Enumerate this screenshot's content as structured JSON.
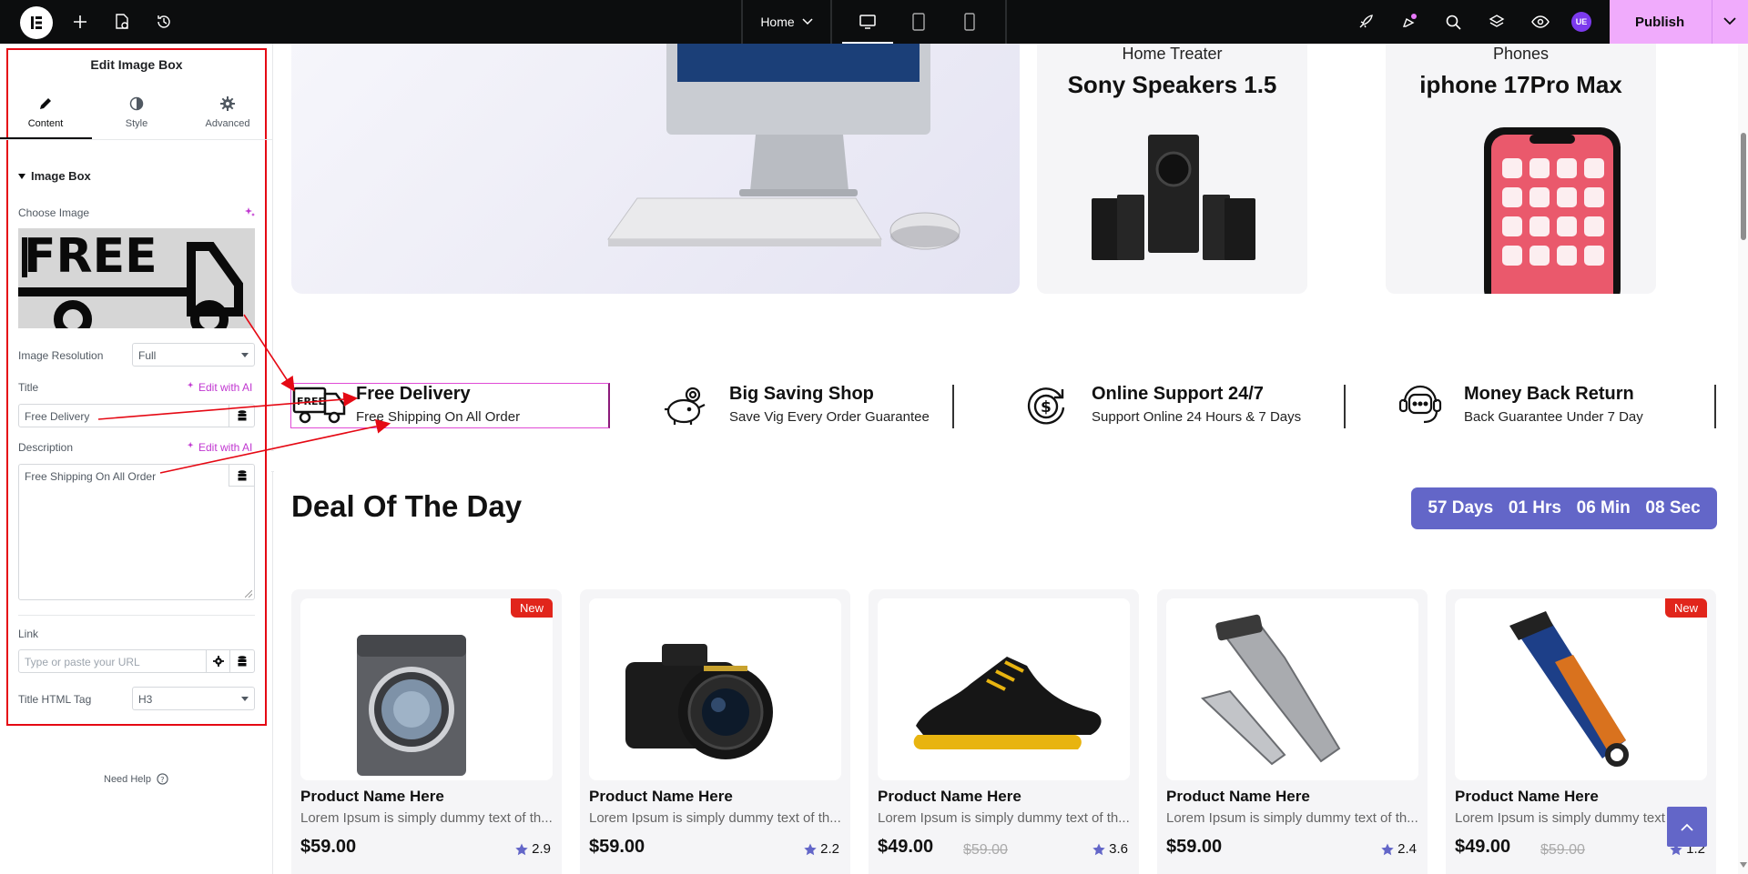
{
  "topbar": {
    "page_select": "Home",
    "publish_label": "Publish",
    "user_initials": "UE"
  },
  "panel": {
    "title": "Edit Image Box",
    "tabs": [
      {
        "label": "Content",
        "icon": "pencil-icon"
      },
      {
        "label": "Style",
        "icon": "contrast-icon"
      },
      {
        "label": "Advanced",
        "icon": "gear-icon"
      }
    ],
    "section_title": "Image Box",
    "choose_image_label": "Choose Image",
    "image_resolution_label": "Image Resolution",
    "image_resolution_value": "Full",
    "title_label": "Title",
    "title_value": "Free Delivery",
    "edit_with_ai": "Edit with AI",
    "description_label": "Description",
    "description_value": "Free Shipping On All Order",
    "link_label": "Link",
    "link_placeholder": "Type or paste your URL",
    "title_tag_label": "Title HTML Tag",
    "title_tag_value": "H3",
    "need_help": "Need Help",
    "frame_color": "#e50914"
  },
  "hero": {
    "cards": [
      {
        "category": "Home Treater",
        "title": "Sony Speakers 1.5"
      },
      {
        "category": "Phones",
        "title": "iphone 17Pro Max"
      }
    ]
  },
  "features": [
    {
      "title": "Free Delivery",
      "desc": "Free Shipping On All Order",
      "icon": "delivery-truck-icon"
    },
    {
      "title": "Big Saving Shop",
      "desc": "Save Vig Every Order Guarantee",
      "icon": "piggy-bank-icon"
    },
    {
      "title": "Online Support 24/7",
      "desc": "Support Online 24 Hours & 7 Days",
      "icon": "dollar-cycle-icon"
    },
    {
      "title": "Money Back Return",
      "desc": "Back Guarantee Under 7 Day",
      "icon": "support-chat-icon"
    }
  ],
  "deal": {
    "title": "Deal Of The Day",
    "countdown": {
      "days": "57 Days",
      "hours": "01 Hrs",
      "minutes": "06 Min",
      "seconds": "08 Sec"
    },
    "accent": "#6366c8"
  },
  "products": [
    {
      "name": "Product Name Here",
      "desc": "Lorem Ipsum is simply dummy text of th...",
      "price": "$59.00",
      "old_price": "",
      "rating": "2.9",
      "badge": "New",
      "image": "washing-machine"
    },
    {
      "name": "Product Name Here",
      "desc": "Lorem Ipsum is simply dummy text of th...",
      "price": "$59.00",
      "old_price": "",
      "rating": "2.2",
      "badge": "",
      "image": "camera"
    },
    {
      "name": "Product Name Here",
      "desc": "Lorem Ipsum is simply dummy text of th...",
      "price": "$49.00",
      "old_price": "$59.00",
      "rating": "3.6",
      "badge": "",
      "image": "sneaker"
    },
    {
      "name": "Product Name Here",
      "desc": "Lorem Ipsum is simply dummy text of th...",
      "price": "$59.00",
      "old_price": "",
      "rating": "2.4",
      "badge": "",
      "image": "hair-clipper"
    },
    {
      "name": "Product Name Here",
      "desc": "Lorem Ipsum is simply dummy text of th...",
      "price": "$49.00",
      "old_price": "$59.00",
      "rating": "1.2",
      "badge": "New",
      "image": "hair-trimmer"
    }
  ]
}
